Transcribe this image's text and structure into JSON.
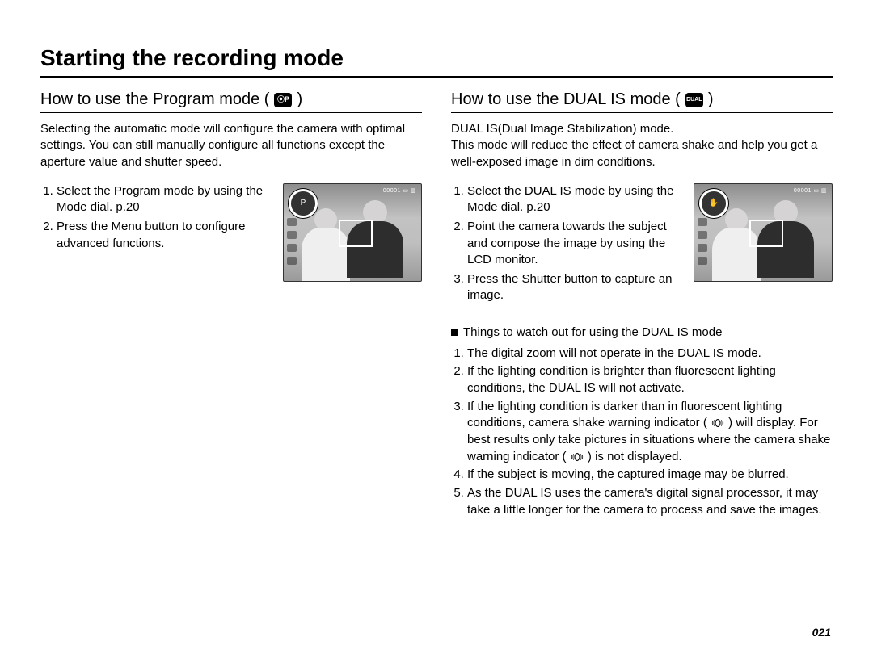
{
  "page_title": "Starting the recording mode",
  "page_number": "021",
  "left": {
    "title_prefix": "How to use the Program mode (",
    "title_suffix": " )",
    "mode_icon_glyph": "⦿P",
    "mode_icon_name": "program-mode-icon",
    "intro": "Selecting the automatic mode will configure the camera with optimal settings. You can still manually configure all functions except the aperture value and shutter speed.",
    "steps": [
      "Select the Program mode by using the Mode dial. p.20",
      "Press the Menu button to configure advanced functions."
    ],
    "lcd_dial_label": "P",
    "lcd_topright": "00001 ▭ ▥"
  },
  "right": {
    "title_prefix": "How to use the DUAL IS mode (",
    "title_suffix": " )",
    "mode_icon_glyph": "DUAL",
    "mode_icon_name": "dual-is-mode-icon",
    "intro": "DUAL IS(Dual Image Stabilization) mode.\nThis mode will reduce the effect of camera shake and help you get a well-exposed image in dim conditions.",
    "steps": [
      "Select the DUAL IS mode by using the Mode dial. p.20",
      "Point the camera towards the subject and compose the image by using the LCD monitor.",
      "Press the Shutter button to capture an image."
    ],
    "lcd_dial_label": "✋",
    "lcd_topright": "00001 ▭ ▥",
    "subheading": "Things to watch out for using the DUAL IS mode",
    "watch_items": [
      "The digital zoom will not operate in the DUAL IS mode.",
      "If the lighting condition is brighter than fluorescent lighting conditions, the DUAL IS will not activate.",
      {
        "pre": "If the lighting condition is darker than in fluorescent lighting conditions, camera shake warning indicator ( ",
        "mid": " ) will display. For best results only take pictures in situations where the camera shake warning indicator ( ",
        "post": " ) is not displayed."
      },
      "If the subject is moving, the captured image may be blurred.",
      "As the DUAL IS uses the camera's digital signal processor, it may take a little longer for the camera to process and save the images."
    ]
  }
}
